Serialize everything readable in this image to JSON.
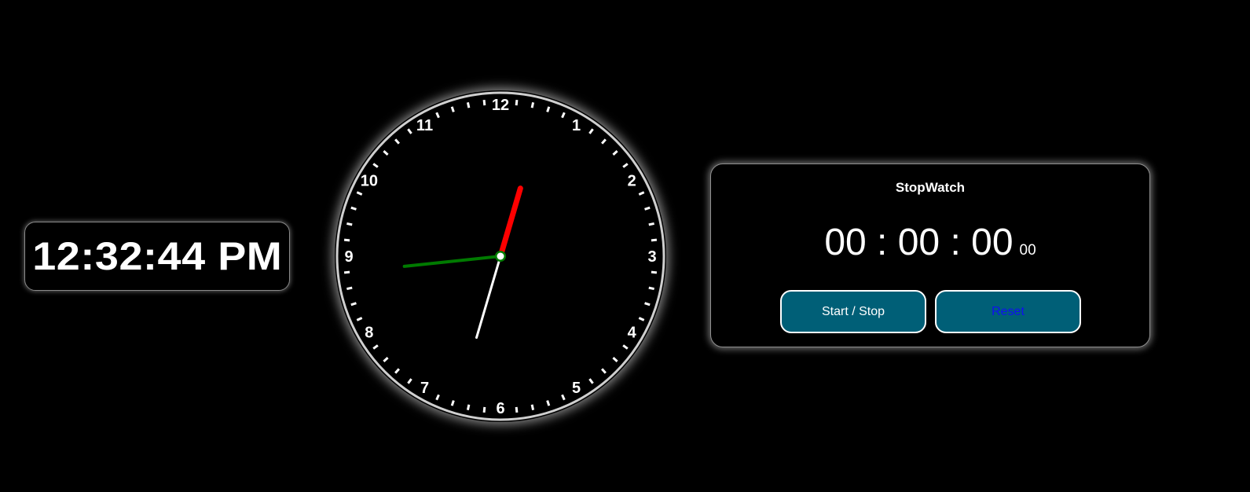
{
  "digital_clock": {
    "time": "12:32:44 PM"
  },
  "analog_clock": {
    "numerals": [
      "12",
      "1",
      "2",
      "3",
      "4",
      "5",
      "6",
      "7",
      "8",
      "9",
      "10",
      "11"
    ],
    "time": {
      "hours": 12,
      "minutes": 32,
      "seconds": 44
    },
    "colors": {
      "hour_hand": "#ff0000",
      "minute_hand": "#ffffff",
      "second_hand": "#007a00",
      "ticks": "#ffffff",
      "numerals": "#ffffff",
      "face": "#000000",
      "border": "#cfcfcf"
    }
  },
  "stopwatch": {
    "title": "StopWatch",
    "hours": "00",
    "minutes": "00",
    "seconds": "00",
    "separator": " : ",
    "milliseconds": "00",
    "start_stop_label": "Start / Stop",
    "reset_label": "Reset",
    "colors": {
      "button_bg": "#005f77",
      "start_text": "#ffffff",
      "reset_text": "#1010f0"
    }
  }
}
